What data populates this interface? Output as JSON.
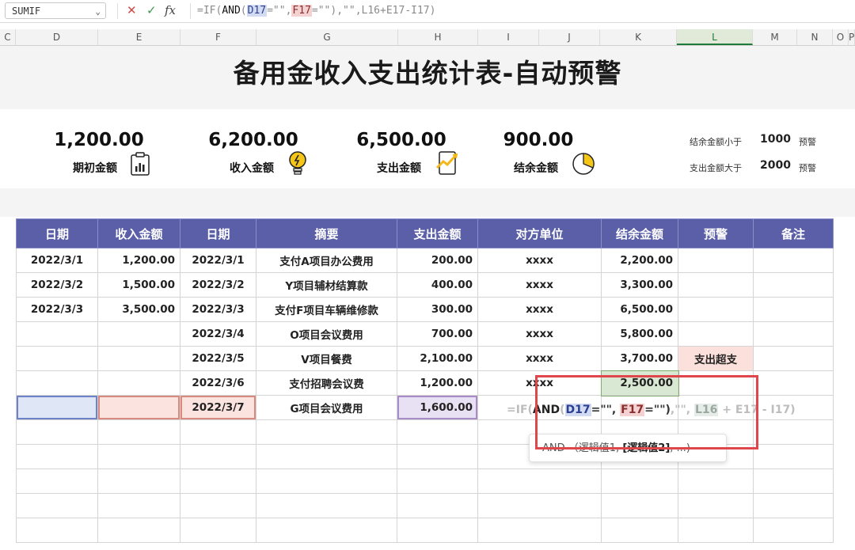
{
  "formula_bar": {
    "name_box": "SUMIF",
    "cancel_symbol": "✕",
    "confirm_symbol": "✓",
    "fx_symbol": "fx",
    "formula_parts": [
      {
        "text": "=IF(",
        "color": "#8a8a8a"
      },
      {
        "text": "AND",
        "color": "#111111"
      },
      {
        "text": "(",
        "color": "#8a8a8a"
      },
      {
        "text": "D17",
        "color": "#2a3f8f",
        "bg": "#d3dbf2"
      },
      {
        "text": "=\"\",",
        "color": "#8a8a8a"
      },
      {
        "text": "F17",
        "color": "#8a2f2f",
        "bg": "#f4d2d2"
      },
      {
        "text": "=\"\"),",
        "color": "#8a8a8a"
      },
      {
        "text": "\"\",L16+E17-I17)",
        "color": "#8a8a8a"
      }
    ]
  },
  "columns": [
    {
      "label": "C",
      "selected": false
    },
    {
      "label": "D",
      "selected": false
    },
    {
      "label": "E",
      "selected": false
    },
    {
      "label": "F",
      "selected": false
    },
    {
      "label": "G",
      "selected": false
    },
    {
      "label": "H",
      "selected": false
    },
    {
      "label": "I",
      "selected": false
    },
    {
      "label": "J",
      "selected": false
    },
    {
      "label": "K",
      "selected": false
    },
    {
      "label": "L",
      "selected": true
    },
    {
      "label": "M",
      "selected": false
    },
    {
      "label": "N",
      "selected": false
    },
    {
      "label": "O",
      "selected": false
    },
    {
      "label": "P",
      "selected": false
    }
  ],
  "title": "备用金收入支出统计表-自动预警",
  "kpis": [
    {
      "value": "1,200.00",
      "label": "期初金额",
      "icon": "clipboard-chart-icon"
    },
    {
      "value": "6,200.00",
      "label": "收入金额",
      "icon": "lightbulb-icon"
    },
    {
      "value": "6,500.00",
      "label": "支出金额",
      "icon": "tablet-chart-icon"
    },
    {
      "value": "900.00",
      "label": "结余金额",
      "icon": "pie-chart-icon"
    }
  ],
  "rules": [
    {
      "prefix": "结余金额小于",
      "value": "1000",
      "suffix": "预警",
      "color": "#4b56a6"
    },
    {
      "prefix": "支出金额大于",
      "value": "2000",
      "suffix": "预警",
      "color": "#e06a2c"
    }
  ],
  "table": {
    "headers": [
      "日期",
      "收入金额",
      "日期",
      "摘要",
      "支出金额",
      "对方单位",
      "结余金额",
      "预警",
      "备注"
    ],
    "rows": [
      [
        "2022/3/1",
        "1,200.00",
        "2022/3/1",
        "支付A项目办公费用",
        "200.00",
        "xxxx",
        "2,200.00",
        "",
        ""
      ],
      [
        "2022/3/2",
        "1,500.00",
        "2022/3/2",
        "Y项目辅材结算款",
        "400.00",
        "xxxx",
        "3,300.00",
        "",
        ""
      ],
      [
        "2022/3/3",
        "3,500.00",
        "2022/3/3",
        "支付F项目车辆维修款",
        "300.00",
        "xxxx",
        "6,500.00",
        "",
        ""
      ],
      [
        "",
        "",
        "2022/3/4",
        "O项目会议费用",
        "700.00",
        "xxxx",
        "5,800.00",
        "",
        ""
      ],
      [
        "",
        "",
        "2022/3/5",
        "V项目餐费",
        "2,100.00",
        "xxxx",
        "3,700.00",
        "支出超支",
        ""
      ],
      [
        "",
        "",
        "2022/3/6",
        "支付招聘会议费",
        "1,200.00",
        "xxxx",
        "2,500.00",
        "",
        ""
      ],
      [
        "",
        "",
        "2022/3/7",
        "G项目会议费用",
        "1,600.00",
        "",
        "",
        "",
        ""
      ]
    ]
  },
  "inline_formula_parts": [
    {
      "text": "=IF(",
      "color": "#bdbdbd"
    },
    {
      "text": "AND",
      "color": "#222222"
    },
    {
      "text": "(",
      "color": "#bdbdbd"
    },
    {
      "text": "D17",
      "color": "#2a3f8f",
      "bg": "#d3dbf2"
    },
    {
      "text": "=\"\", ",
      "color": "#333333"
    },
    {
      "text": "F17",
      "color": "#8a2f2f",
      "bg": "#f4d2d2"
    },
    {
      "text": "=\"\")",
      "color": "#333333"
    },
    {
      "text": ",\"\", ",
      "color": "#bdbdbd"
    },
    {
      "text": "L16",
      "color": "#9aa8a0",
      "bg": "#e6ece8"
    },
    {
      "text": " + E17 - I17)",
      "color": "#bdbdbd"
    }
  ],
  "tooltip": {
    "fn": "AND",
    "args": "（逻辑值1, ",
    "bold_arg": "[逻辑值2]",
    "tail": ", ...)"
  },
  "warning_color": "#fbe0dc",
  "header_color": "#5a5fa8"
}
